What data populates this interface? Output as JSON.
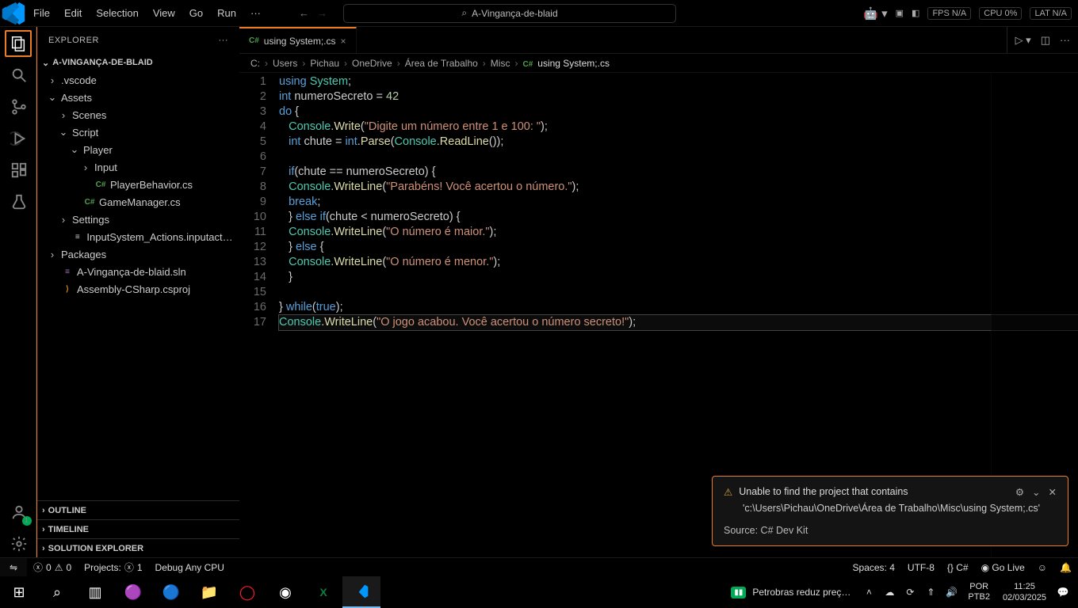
{
  "titlebar": {
    "menu": [
      "File",
      "Edit",
      "Selection",
      "View",
      "Go",
      "Run",
      "···"
    ],
    "search_title": "A-Vingança-de-blaid",
    "right_metrics": {
      "fps": "FPS N/A",
      "cpu": "CPU 0%",
      "lat": "LAT N/A"
    }
  },
  "sidebar": {
    "header": "EXPLORER",
    "root": "A-VINGANÇA-DE-BLAID",
    "tree": [
      {
        "indent": 1,
        "twist": "›",
        "label": ".vscode",
        "leaf": false
      },
      {
        "indent": 1,
        "twist": "⌄",
        "label": "Assets",
        "leaf": false
      },
      {
        "indent": 2,
        "twist": "›",
        "label": "Scenes",
        "leaf": false
      },
      {
        "indent": 2,
        "twist": "⌄",
        "label": "Script",
        "leaf": false
      },
      {
        "indent": 3,
        "twist": "⌄",
        "label": "Player",
        "leaf": false
      },
      {
        "indent": 4,
        "twist": "›",
        "label": "Input",
        "leaf": false
      },
      {
        "indent": 4,
        "twist": "",
        "icon": "C#",
        "iconClass": "col-cs",
        "label": "PlayerBehavior.cs",
        "leaf": true
      },
      {
        "indent": 3,
        "twist": "",
        "icon": "C#",
        "iconClass": "col-cs",
        "label": "GameManager.cs",
        "leaf": true
      },
      {
        "indent": 2,
        "twist": "›",
        "label": "Settings",
        "leaf": false
      },
      {
        "indent": 2,
        "twist": "",
        "icon": "≡",
        "iconClass": "col-folder",
        "label": "InputSystem_Actions.inputactions",
        "leaf": true
      },
      {
        "indent": 1,
        "twist": "›",
        "label": "Packages",
        "leaf": false
      },
      {
        "indent": 1,
        "twist": "",
        "icon": "≡",
        "iconClass": "col-sln",
        "label": "A-Vingança-de-blaid.sln",
        "leaf": true
      },
      {
        "indent": 1,
        "twist": "",
        "icon": "⟩",
        "iconClass": "col-orange",
        "label": "Assembly-CSharp.csproj",
        "leaf": true
      }
    ],
    "panels": [
      "OUTLINE",
      "TIMELINE",
      "SOLUTION EXPLORER"
    ]
  },
  "tabs": {
    "active": {
      "icon": "C#",
      "label": "using System;.cs"
    }
  },
  "breadcrumbs": [
    "C:",
    "Users",
    "Pichau",
    "OneDrive",
    "Área de Trabalho",
    "Misc",
    "using System;.cs"
  ],
  "code": {
    "lines": [
      "<span class='tok-kw'>using</span> <span class='tok-type'>System</span>;",
      "<span class='tok-kw'>int</span> numeroSecreto = <span class='tok-num'>42</span>",
      "<span class='tok-kw'>do</span> {",
      "   <span class='tok-type'>Console</span>.<span class='tok-fn'>Write</span>(<span class='tok-str'>\"Digite um número entre 1 e 100: \"</span>);",
      "   <span class='tok-kw'>int</span> chute = <span class='tok-kw'>int</span>.<span class='tok-fn'>Parse</span>(<span class='tok-type'>Console</span>.<span class='tok-fn'>ReadLine</span>());",
      "",
      "   <span class='tok-kw'>if</span>(chute == numeroSecreto) {",
      "   <span class='tok-type'>Console</span>.<span class='tok-fn'>WriteLine</span>(<span class='tok-str'>\"Parabéns! Você acertou o número.\"</span>);",
      "   <span class='tok-kw'>break</span>;",
      "   } <span class='tok-kw'>else</span> <span class='tok-kw'>if</span>(chute &lt; numeroSecreto) {",
      "   <span class='tok-type'>Console</span>.<span class='tok-fn'>WriteLine</span>(<span class='tok-str'>\"O número é maior.\"</span>);",
      "   } <span class='tok-kw'>else</span> {",
      "   <span class='tok-type'>Console</span>.<span class='tok-fn'>WriteLine</span>(<span class='tok-str'>\"O número é menor.\"</span>);",
      "   }",
      "",
      "} <span class='tok-kw'>while</span>(<span class='tok-const'>true</span>);",
      "<span class='tok-type'>Console</span>.<span class='tok-fn'>WriteLine</span>(<span class='tok-str'>\"O jogo acabou. Você acertou o número secreto!\"</span>);"
    ],
    "current_line_index": 16
  },
  "notification": {
    "title": "Unable to find the project that contains",
    "body": "'c:\\Users\\Pichau\\OneDrive\\Área de Trabalho\\Misc\\using System;.cs'",
    "source": "Source: C# Dev Kit"
  },
  "statusbar": {
    "errors": "0",
    "warnings": "0",
    "projects_label": "Projects:",
    "projects_badge": "1",
    "debug": "Debug Any CPU",
    "spaces": "Spaces: 4",
    "encoding": "UTF-8",
    "lang": "{} C#",
    "golive": "◉ Go Live"
  },
  "taskbar": {
    "news": "Petrobras reduz preç…",
    "lang1": "POR",
    "lang2": "PTB2",
    "time": "11:25",
    "date": "02/03/2025"
  }
}
